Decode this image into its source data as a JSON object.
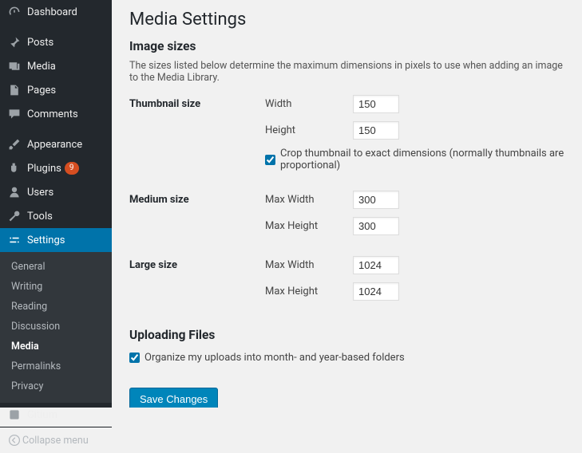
{
  "sidebar": {
    "items": [
      {
        "label": "Dashboard"
      },
      {
        "label": "Posts"
      },
      {
        "label": "Media"
      },
      {
        "label": "Pages"
      },
      {
        "label": "Comments"
      },
      {
        "label": "Appearance"
      },
      {
        "label": "Plugins",
        "badge": "9"
      },
      {
        "label": "Users"
      },
      {
        "label": "Tools"
      },
      {
        "label": "Settings"
      },
      {
        "label": "Gitium"
      }
    ],
    "submenu": [
      "General",
      "Writing",
      "Reading",
      "Discussion",
      "Media",
      "Permalinks",
      "Privacy"
    ],
    "collapse": "Collapse menu"
  },
  "page": {
    "title": "Media Settings",
    "section1": "Image sizes",
    "desc": "The sizes listed below determine the maximum dimensions in pixels to use when adding an image to the Media Library.",
    "thumb_label": "Thumbnail size",
    "width_label": "Width",
    "height_label": "Height",
    "thumb_w": "150",
    "thumb_h": "150",
    "crop_label": "Crop thumbnail to exact dimensions (normally thumbnails are proportional)",
    "medium_label": "Medium size",
    "maxw_label": "Max Width",
    "maxh_label": "Max Height",
    "medium_w": "300",
    "medium_h": "300",
    "large_label": "Large size",
    "large_w": "1024",
    "large_h": "1024",
    "section2": "Uploading Files",
    "organize_label": "Organize my uploads into month- and year-based folders",
    "save": "Save Changes"
  }
}
